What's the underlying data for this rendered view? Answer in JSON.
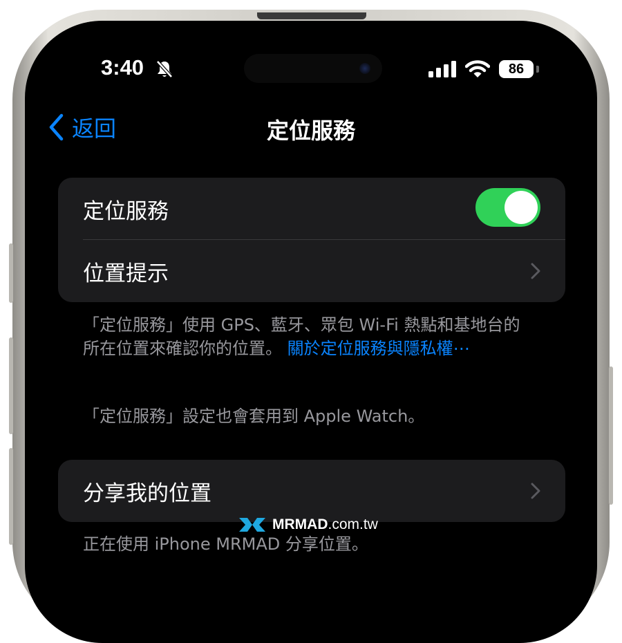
{
  "status_bar": {
    "time": "3:40",
    "battery": "86",
    "silent_icon": "bell-slash-icon",
    "signal_icon": "cellular-signal-icon",
    "wifi_icon": "wifi-icon"
  },
  "nav": {
    "back_label": "返回",
    "title": "定位服務"
  },
  "group1": {
    "row1_label": "定位服務",
    "toggle_on": true,
    "row2_label": "位置提示"
  },
  "footnote1": {
    "text": "「定位服務」使用 GPS、藍牙、眾包 Wi-Fi 熱點和基地台的所在位置來確認你的位置。",
    "link": "關於定位服務與隱私權⋯"
  },
  "footnote2": "「定位服務」設定也會套用到 Apple Watch。",
  "group2": {
    "row1_label": "分享我的位置"
  },
  "footnote3": "正在使用 iPhone MRMAD 分享位置。",
  "watermark": {
    "brand": "MRMAD",
    "domain": ".com.tw"
  },
  "colors": {
    "accent": "#0a84ff",
    "toggle_on": "#30d158",
    "cell_bg": "#1c1c1e",
    "background": "#000000"
  }
}
